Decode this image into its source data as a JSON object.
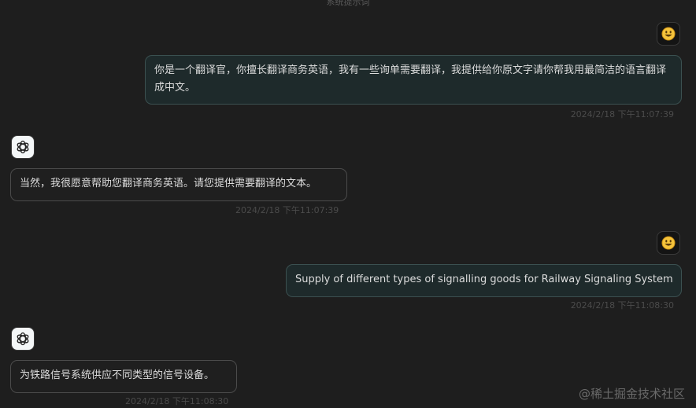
{
  "header": {
    "hint": "系统提示词"
  },
  "messages": [
    {
      "role": "user",
      "text": "你是一个翻译官，你擅长翻译商务英语，我有一些询单需要翻译，我提供给你原文字请你帮我用最简洁的语言翻译成中文。",
      "time": "2024/2/18 下午11:07:39",
      "avatar_icon": "smiley-emoji-icon"
    },
    {
      "role": "assistant",
      "text": "当然，我很愿意帮助您翻译商务英语。请您提供需要翻译的文本。",
      "time": "2024/2/18 下午11:07:39",
      "avatar_icon": "openai-logo-icon"
    },
    {
      "role": "user",
      "text": "Supply of different types of signalling goods for Railway Signaling System",
      "time": "2024/2/18 下午11:08:30",
      "avatar_icon": "smiley-emoji-icon"
    },
    {
      "role": "assistant",
      "text": "为铁路信号系统供应不同类型的信号设备。",
      "time": "2024/2/18 下午11:08:30",
      "avatar_icon": "openai-logo-icon"
    }
  ],
  "watermark": "@稀土掘金技术社区"
}
